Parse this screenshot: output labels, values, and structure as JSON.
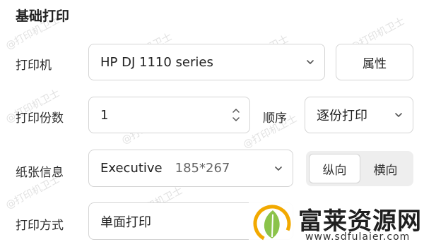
{
  "section_title": "基础打印",
  "printer": {
    "label": "打印机",
    "value": "HP DJ 1110 series",
    "properties_button": "属性"
  },
  "copies": {
    "label": "打印份数",
    "value": "1",
    "order_label": "顺序",
    "order_value": "逐份打印"
  },
  "paper": {
    "label": "纸张信息",
    "name": "Executive",
    "size": "185*267",
    "orientation": {
      "portrait": "纵向",
      "landscape": "横向",
      "selected": "portrait"
    }
  },
  "mode": {
    "label": "打印方式",
    "value": "单面打印"
  },
  "watermark": {
    "text": "@打印机卫士"
  },
  "brand": {
    "name": "富莱资源网",
    "url": "www.sdfulaier.com",
    "leaf_color": "#f2a900",
    "leaf_inner_color": "#8bc34a"
  },
  "colors": {
    "border": "#d4d4d4",
    "segment_bg": "#eeeeee"
  }
}
